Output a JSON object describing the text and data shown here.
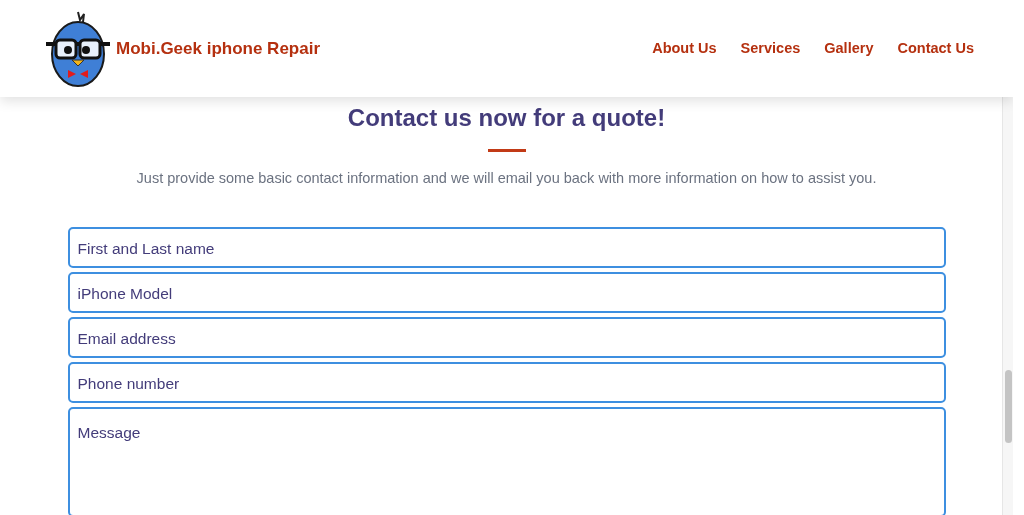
{
  "header": {
    "brand": "Mobi.Geek iphone Repair",
    "nav": [
      {
        "label": "About Us"
      },
      {
        "label": "Services"
      },
      {
        "label": "Gallery"
      },
      {
        "label": "Contact Us"
      }
    ]
  },
  "contact": {
    "heading": "Contact us now for a quote!",
    "intro": "Just provide some basic contact information and we will email you back with more information on how to assist you.",
    "fields": [
      {
        "kind": "input",
        "placeholder": "First and Last name"
      },
      {
        "kind": "input",
        "placeholder": "iPhone Model"
      },
      {
        "kind": "input",
        "placeholder": "Email address"
      },
      {
        "kind": "input",
        "placeholder": "Phone number"
      },
      {
        "kind": "textarea",
        "placeholder": "Message"
      }
    ]
  }
}
